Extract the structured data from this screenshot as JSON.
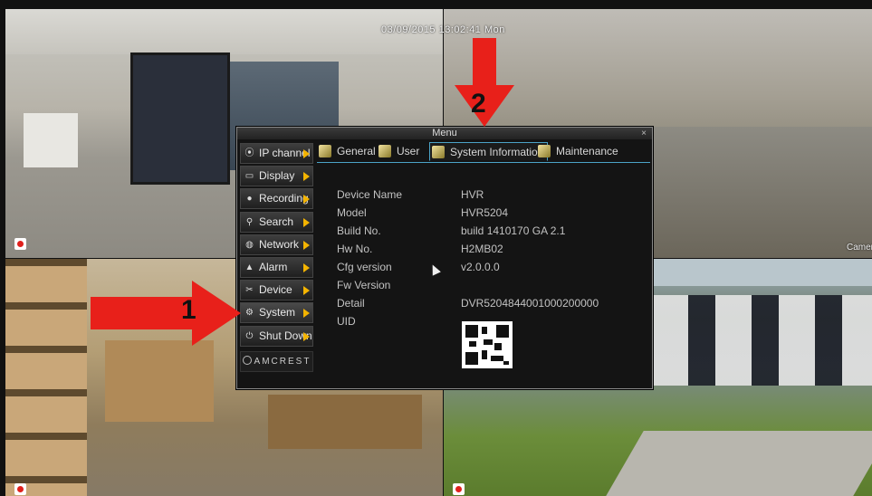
{
  "overlay": {
    "datetime": "03/09/2015 13:02:41 Mon",
    "camera_label": "Camer",
    "step1": "1",
    "step2": "2"
  },
  "menu": {
    "title": "Menu",
    "close": "×",
    "sidebar": [
      {
        "label": "IP channel",
        "icon": "ip-channel-icon"
      },
      {
        "label": "Display",
        "icon": "display-icon"
      },
      {
        "label": "Recording",
        "icon": "recording-icon"
      },
      {
        "label": "Search",
        "icon": "search-icon"
      },
      {
        "label": "Network",
        "icon": "network-icon"
      },
      {
        "label": "Alarm",
        "icon": "alarm-icon"
      },
      {
        "label": "Device",
        "icon": "device-icon"
      },
      {
        "label": "System",
        "icon": "gear-icon"
      },
      {
        "label": "Shut Down",
        "icon": "power-icon"
      }
    ],
    "logo": "AMCREST",
    "tabs": [
      {
        "label": "General",
        "active": false
      },
      {
        "label": "User",
        "active": false
      },
      {
        "label": "System Information",
        "active": true
      },
      {
        "label": "Maintenance",
        "active": false
      }
    ],
    "info": [
      {
        "label": "Device Name",
        "value": "HVR"
      },
      {
        "label": "Model",
        "value": "HVR5204"
      },
      {
        "label": "Build No.",
        "value": "build 1410170 GA 2.1"
      },
      {
        "label": "Hw No.",
        "value": "H2MB02"
      },
      {
        "label": "Cfg version",
        "value": "v2.0.0.0"
      },
      {
        "label": "Fw Version",
        "value": ""
      },
      {
        "label": "Detail",
        "value": "DVR5204844001000200000"
      },
      {
        "label": "UID",
        "value": ""
      }
    ]
  },
  "colors": {
    "accent": "#4ba3c7",
    "arrow": "#e8201a",
    "indicator": "#f4b400"
  }
}
